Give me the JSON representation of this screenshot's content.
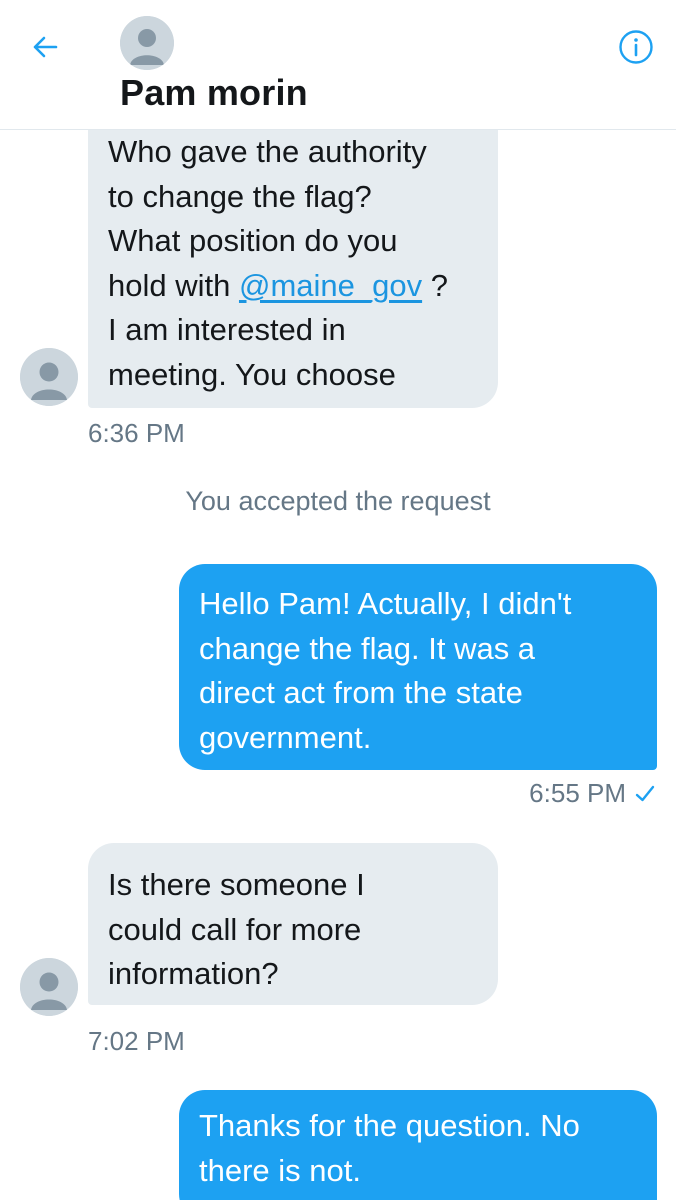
{
  "header": {
    "contact_name": "Pam morin",
    "back_icon": "arrow-left-icon",
    "info_icon": "info-circle-icon",
    "accent_color": "#1da1f2"
  },
  "messages": [
    {
      "direction": "incoming",
      "text_before": "Who gave the authority\nto change the flag?\nWhat position do you\nhold with ",
      "mention": "@maine_gov",
      "text_after": " ?\nI am interested in\nmeeting. You choose",
      "time": "6:36 PM"
    },
    {
      "direction": "system",
      "text": "You accepted the request"
    },
    {
      "direction": "outgoing",
      "text": "Hello Pam! Actually, I didn't\nchange the flag. It was a\ndirect act from the state\ngovernment.",
      "time": "6:55 PM",
      "status_icon": "checkmark-icon"
    },
    {
      "direction": "incoming",
      "text": "Is there someone I\ncould call for more\ninformation?",
      "time": "7:02 PM"
    },
    {
      "direction": "outgoing",
      "text": "Thanks for the question. No\nthere is not."
    }
  ],
  "colors": {
    "incoming_bubble": "#e6ecf0",
    "outgoing_bubble": "#1da1f2",
    "timestamp": "#657786"
  }
}
